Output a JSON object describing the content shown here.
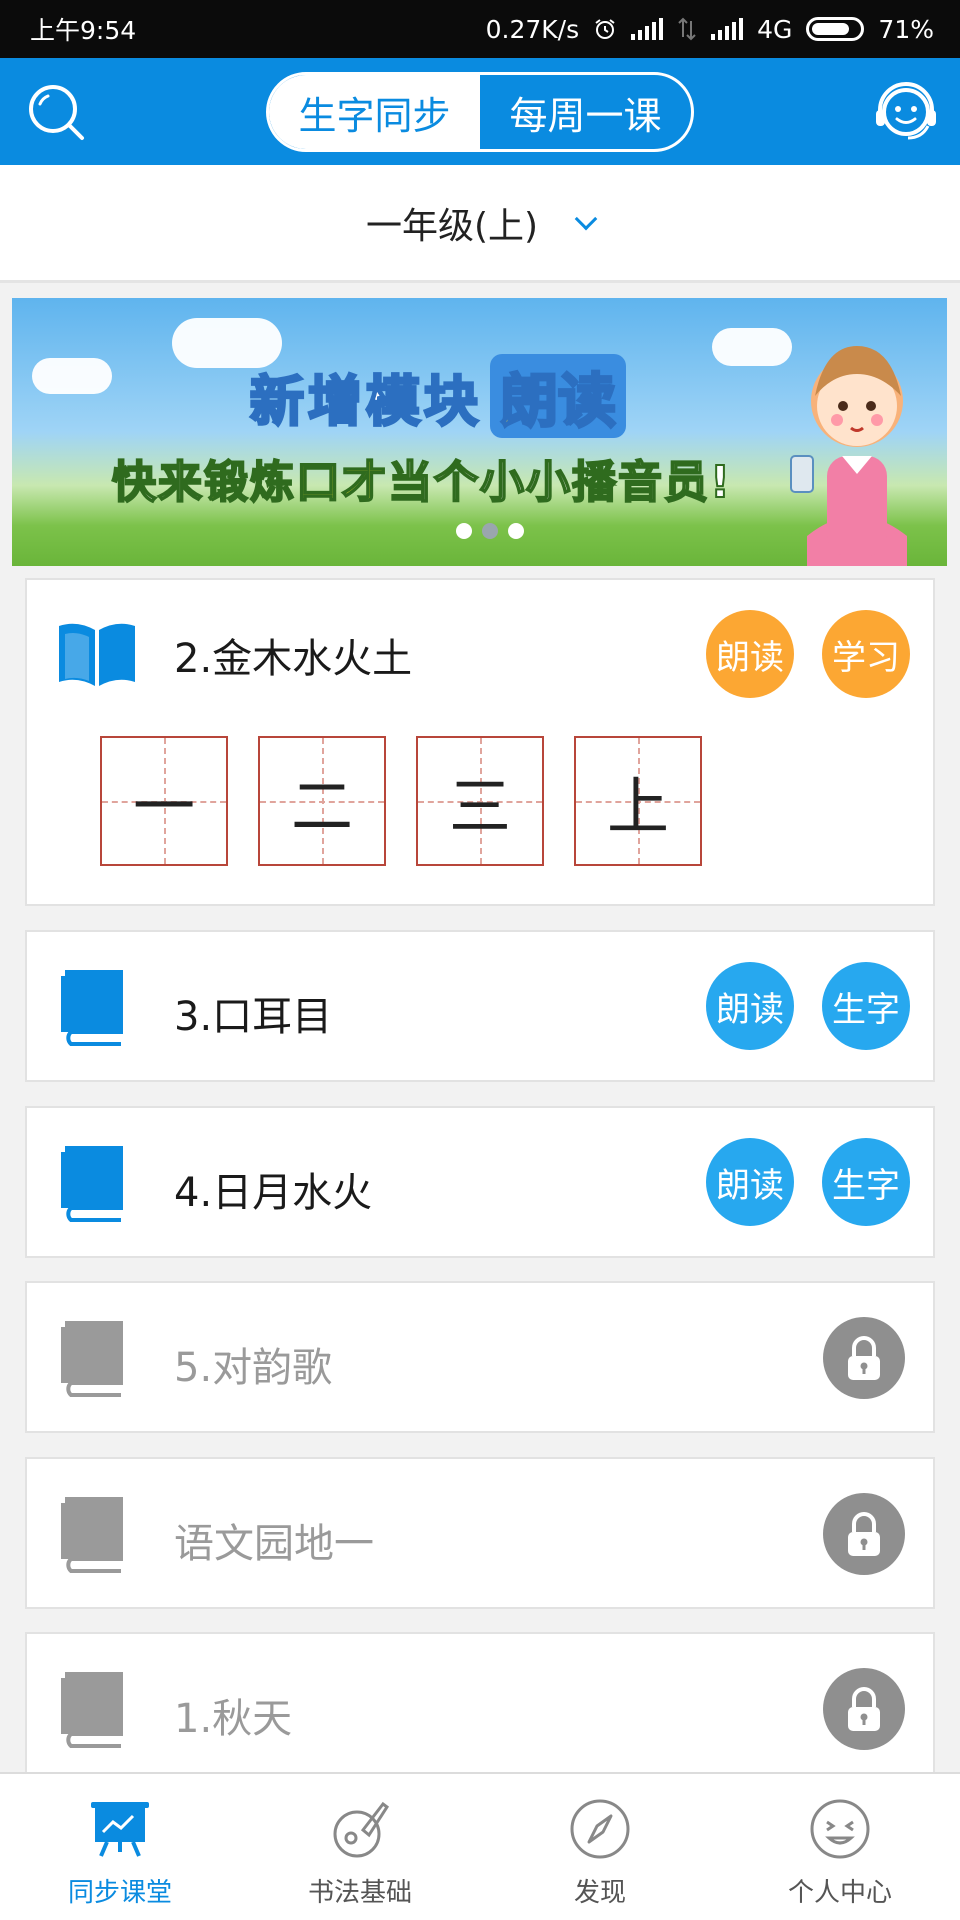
{
  "status_bar": {
    "time": "上午9:54",
    "network_speed": "0.27K/s",
    "network_type": "4G",
    "battery": "71%"
  },
  "header": {
    "tabs": [
      {
        "label": "生字同步",
        "active": true
      },
      {
        "label": "每周一课",
        "active": false
      }
    ],
    "icons": [
      "search-icon",
      "customer-service-icon"
    ]
  },
  "grade_selector": {
    "label": "一年级(上)"
  },
  "banner": {
    "title": "新增模块",
    "highlight": "朗读",
    "subtitle_prefix": "快来",
    "subtitle_highlight": "锻炼口才",
    "subtitle_suffix": "当个小小播音员!",
    "page_count": 3,
    "active_page": 2
  },
  "lessons": [
    {
      "title": "2.金木水火土",
      "status": "expanded",
      "buttons": [
        "朗读",
        "学习"
      ],
      "characters": [
        "一",
        "二",
        "三",
        "上"
      ]
    },
    {
      "title": "3.口耳目",
      "status": "open",
      "buttons": [
        "朗读",
        "生字"
      ]
    },
    {
      "title": "4.日月水火",
      "status": "open",
      "buttons": [
        "朗读",
        "生字"
      ]
    },
    {
      "title": "5.对韵歌",
      "status": "locked"
    },
    {
      "title": "语文园地一",
      "status": "locked"
    },
    {
      "title": "1.秋天",
      "status": "locked"
    }
  ],
  "tab_bar": {
    "items": [
      {
        "label": "同步课堂",
        "active": true
      },
      {
        "label": "书法基础",
        "active": false
      },
      {
        "label": "发现",
        "active": false
      },
      {
        "label": "个人中心",
        "active": false
      }
    ]
  },
  "colors": {
    "primary": "#0a8be0",
    "orange_button": "#fca733",
    "blue_button": "#27a8ef",
    "locked_gray": "#8f8f8f"
  }
}
